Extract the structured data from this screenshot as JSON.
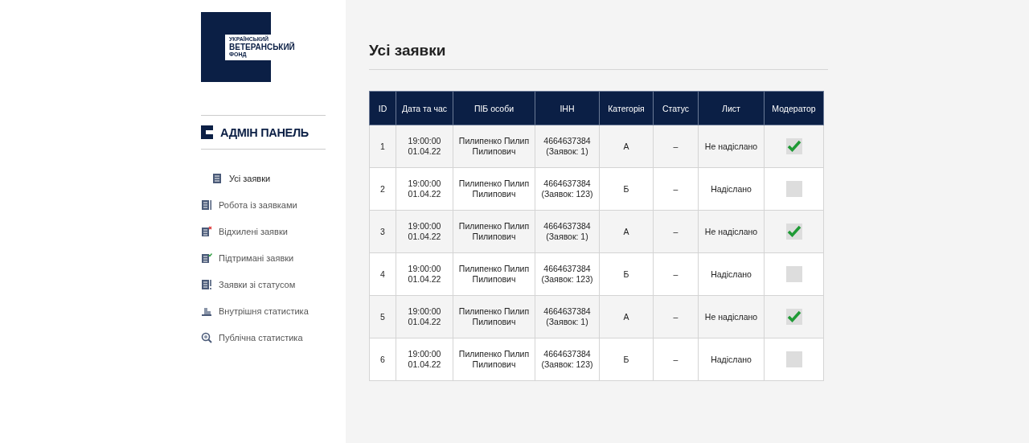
{
  "logo": {
    "lines": [
      "УКРАЇНСЬКИЙ",
      "ВЕТЕРАНСЬКИЙ",
      "ФОНД"
    ]
  },
  "panel_title": "АДМІН ПАНЕЛЬ",
  "menu": [
    {
      "label": "Усі заявки",
      "kind": "list",
      "selected": true
    },
    {
      "label": "Робота із заявками",
      "kind": "list-bar",
      "selected": false
    },
    {
      "label": "Відхилені заявки",
      "kind": "list-cross",
      "selected": false
    },
    {
      "label": "Підтримані заявки",
      "kind": "list-check",
      "selected": false
    },
    {
      "label": "Заявки зі статусом",
      "kind": "list-alert",
      "selected": false
    },
    {
      "label": "Внутрішня статистика",
      "kind": "chart",
      "selected": false
    },
    {
      "label": "Публічна статистика",
      "kind": "magnifier",
      "selected": false
    }
  ],
  "page_title": "Усі заявки",
  "table": {
    "columns": [
      "ID",
      "Дата та час",
      "ПІБ особи",
      "ІНН",
      "Категорія",
      "Статус",
      "Лист",
      "Модератор"
    ],
    "rows": [
      {
        "id": "1",
        "datetime": [
          "19:00:00",
          "01.04.22"
        ],
        "name": [
          "Пилипенко Пилип",
          "Пилипович"
        ],
        "inn": [
          "4664637384",
          "(Заявок: 1)"
        ],
        "category": "А",
        "status": "–",
        "letter": "Не надіслано",
        "moderator_checked": true
      },
      {
        "id": "2",
        "datetime": [
          "19:00:00",
          "01.04.22"
        ],
        "name": [
          "Пилипенко Пилип",
          "Пилипович"
        ],
        "inn": [
          "4664637384",
          "(Заявок: 123)"
        ],
        "category": "Б",
        "status": "–",
        "letter": "Надіслано",
        "moderator_checked": false
      },
      {
        "id": "3",
        "datetime": [
          "19:00:00",
          "01.04.22"
        ],
        "name": [
          "Пилипенко Пилип",
          "Пилипович"
        ],
        "inn": [
          "4664637384",
          "(Заявок: 1)"
        ],
        "category": "А",
        "status": "–",
        "letter": "Не надіслано",
        "moderator_checked": true
      },
      {
        "id": "4",
        "datetime": [
          "19:00:00",
          "01.04.22"
        ],
        "name": [
          "Пилипенко Пилип",
          "Пилипович"
        ],
        "inn": [
          "4664637384",
          "(Заявок: 123)"
        ],
        "category": "Б",
        "status": "–",
        "letter": "Надіслано",
        "moderator_checked": false
      },
      {
        "id": "5",
        "datetime": [
          "19:00:00",
          "01.04.22"
        ],
        "name": [
          "Пилипенко Пилип",
          "Пилипович"
        ],
        "inn": [
          "4664637384",
          "(Заявок: 1)"
        ],
        "category": "А",
        "status": "–",
        "letter": "Не надіслано",
        "moderator_checked": true
      },
      {
        "id": "6",
        "datetime": [
          "19:00:00",
          "01.04.22"
        ],
        "name": [
          "Пилипенко Пилип",
          "Пилипович"
        ],
        "inn": [
          "4664637384",
          "(Заявок: 123)"
        ],
        "category": "Б",
        "status": "–",
        "letter": "Надіслано",
        "moderator_checked": false
      }
    ]
  }
}
